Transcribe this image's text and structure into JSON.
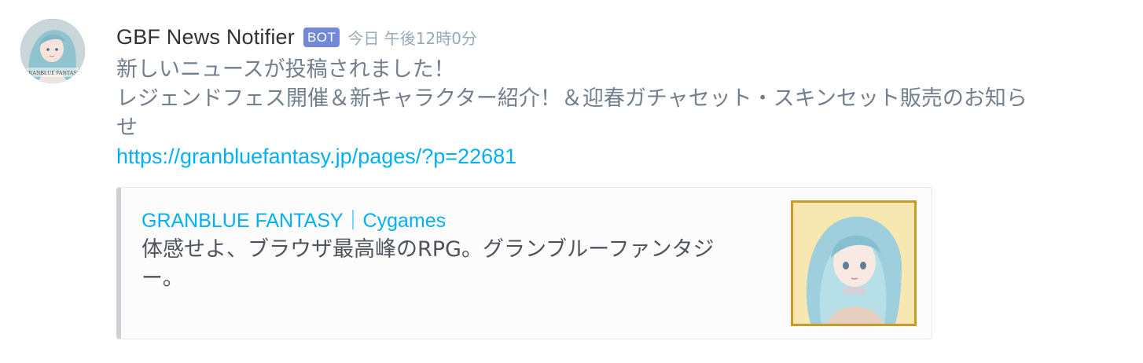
{
  "message": {
    "author": "GBF News Notifier",
    "bot_badge": "BOT",
    "timestamp": "今日 午後12時0分",
    "lines": [
      "新しいニュースが投稿されました！",
      "レジェンドフェス開催＆新キャラクター紹介！＆迎春ガチャセット・スキンセット販売のお知ら",
      "せ"
    ],
    "link": "https://granbluefantasy.jp/pages/?p=22681"
  },
  "avatar": {
    "logo_text": "GRANBLUE FANTASY"
  },
  "embed": {
    "provider": "GRANBLUE FANTASY｜Cygames",
    "description_lines": [
      "体感せよ、ブラウザ最高峰のRPG。グランブルーファンタジ",
      "ー。"
    ],
    "accent_color": "#cfd1d4",
    "link_color": "#00b0f4"
  },
  "colors": {
    "bot_badge": "#7289da",
    "username": "#2e3338",
    "timestamp": "#99aab5",
    "thumbnail_border": "#c89a2a"
  }
}
